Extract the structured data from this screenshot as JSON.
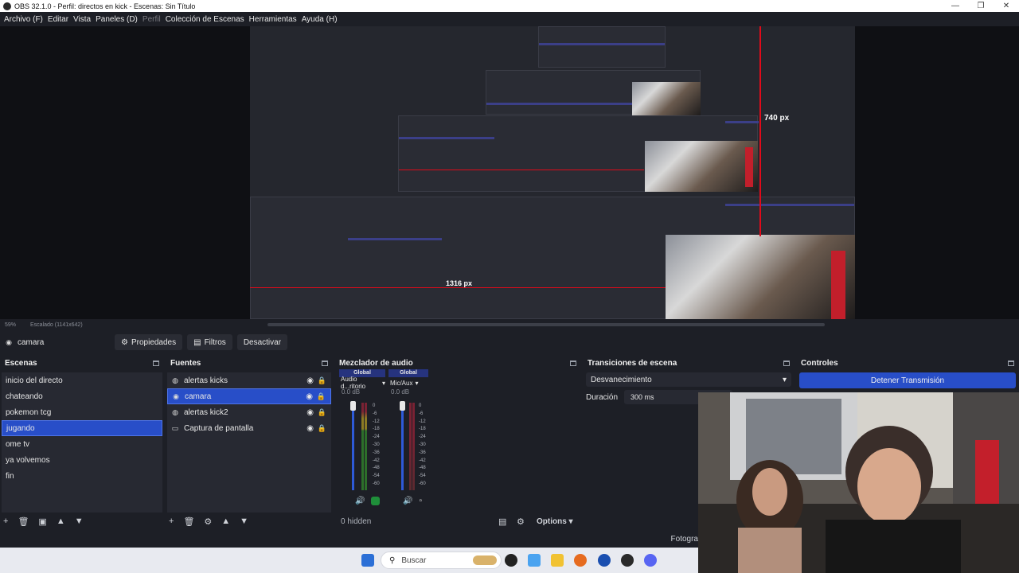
{
  "window": {
    "title": "OBS 32.1.0 - Perfil: directos en kick - Escenas: Sin Título",
    "controls": [
      "—",
      "❐",
      "✕"
    ]
  },
  "menu": {
    "items": [
      {
        "label": "Archivo (F)",
        "enabled": true
      },
      {
        "label": "Editar",
        "enabled": true
      },
      {
        "label": "Vista",
        "enabled": true
      },
      {
        "label": "Paneles (D)",
        "enabled": true
      },
      {
        "label": "Perfil",
        "enabled": false
      },
      {
        "label": "Colección de Escenas",
        "enabled": true
      },
      {
        "label": "Herramientas",
        "enabled": true
      },
      {
        "label": "Ayuda (H)",
        "enabled": true
      }
    ]
  },
  "preview": {
    "label_height": "740 px",
    "label_width": "1316 px",
    "zoom": "59%",
    "scaling": "Escalado (1141x642)"
  },
  "context_bar": {
    "source_name": "camara",
    "properties_label": "Propiedades",
    "filters_label": "Filtros",
    "deactivate_label": "Desactivar"
  },
  "scenes": {
    "title": "Escenas",
    "items": [
      "inicio del directo",
      "chateando",
      "pokemon tcg",
      "jugando",
      "ome tv",
      "ya volvemos",
      "fin"
    ],
    "selected": "jugando"
  },
  "sources": {
    "title": "Fuentes",
    "items": [
      {
        "name": "alertas kicks",
        "icon": "browser-icon"
      },
      {
        "name": "camara",
        "icon": "camera-icon"
      },
      {
        "name": "alertas kick2",
        "icon": "browser-icon"
      },
      {
        "name": "Captura de pantalla",
        "icon": "monitor-icon"
      }
    ],
    "selected": "camara"
  },
  "mixer": {
    "title": "Mezclador de audio",
    "channels": [
      {
        "tag": "Global",
        "name": "Audio d...ritorio",
        "db": "0.0 dB"
      },
      {
        "tag": "Global",
        "name": "Mic/Aux",
        "db": "0.0 dB"
      }
    ],
    "scale": [
      "0",
      "-6",
      "-12",
      "-18",
      "-24",
      "-30",
      "-36",
      "-42",
      "-48",
      "-54",
      "-60"
    ],
    "hidden_label": "0 hidden",
    "options_label": "Options"
  },
  "transitions": {
    "title": "Transiciones de escena",
    "selected": "Desvanecimiento",
    "duration_label": "Duración",
    "duration_value": "300 ms"
  },
  "controls": {
    "title": "Controles",
    "stop_stream_label": "Detener Transmisión"
  },
  "status": {
    "partial_text": "Fotogra"
  },
  "taskbar": {
    "search_placeholder": "Buscar"
  },
  "colors": {
    "accent": "#284ec8",
    "guide": "#e00a1a",
    "panel_bg": "#1d1f26",
    "list_bg": "#272932"
  }
}
